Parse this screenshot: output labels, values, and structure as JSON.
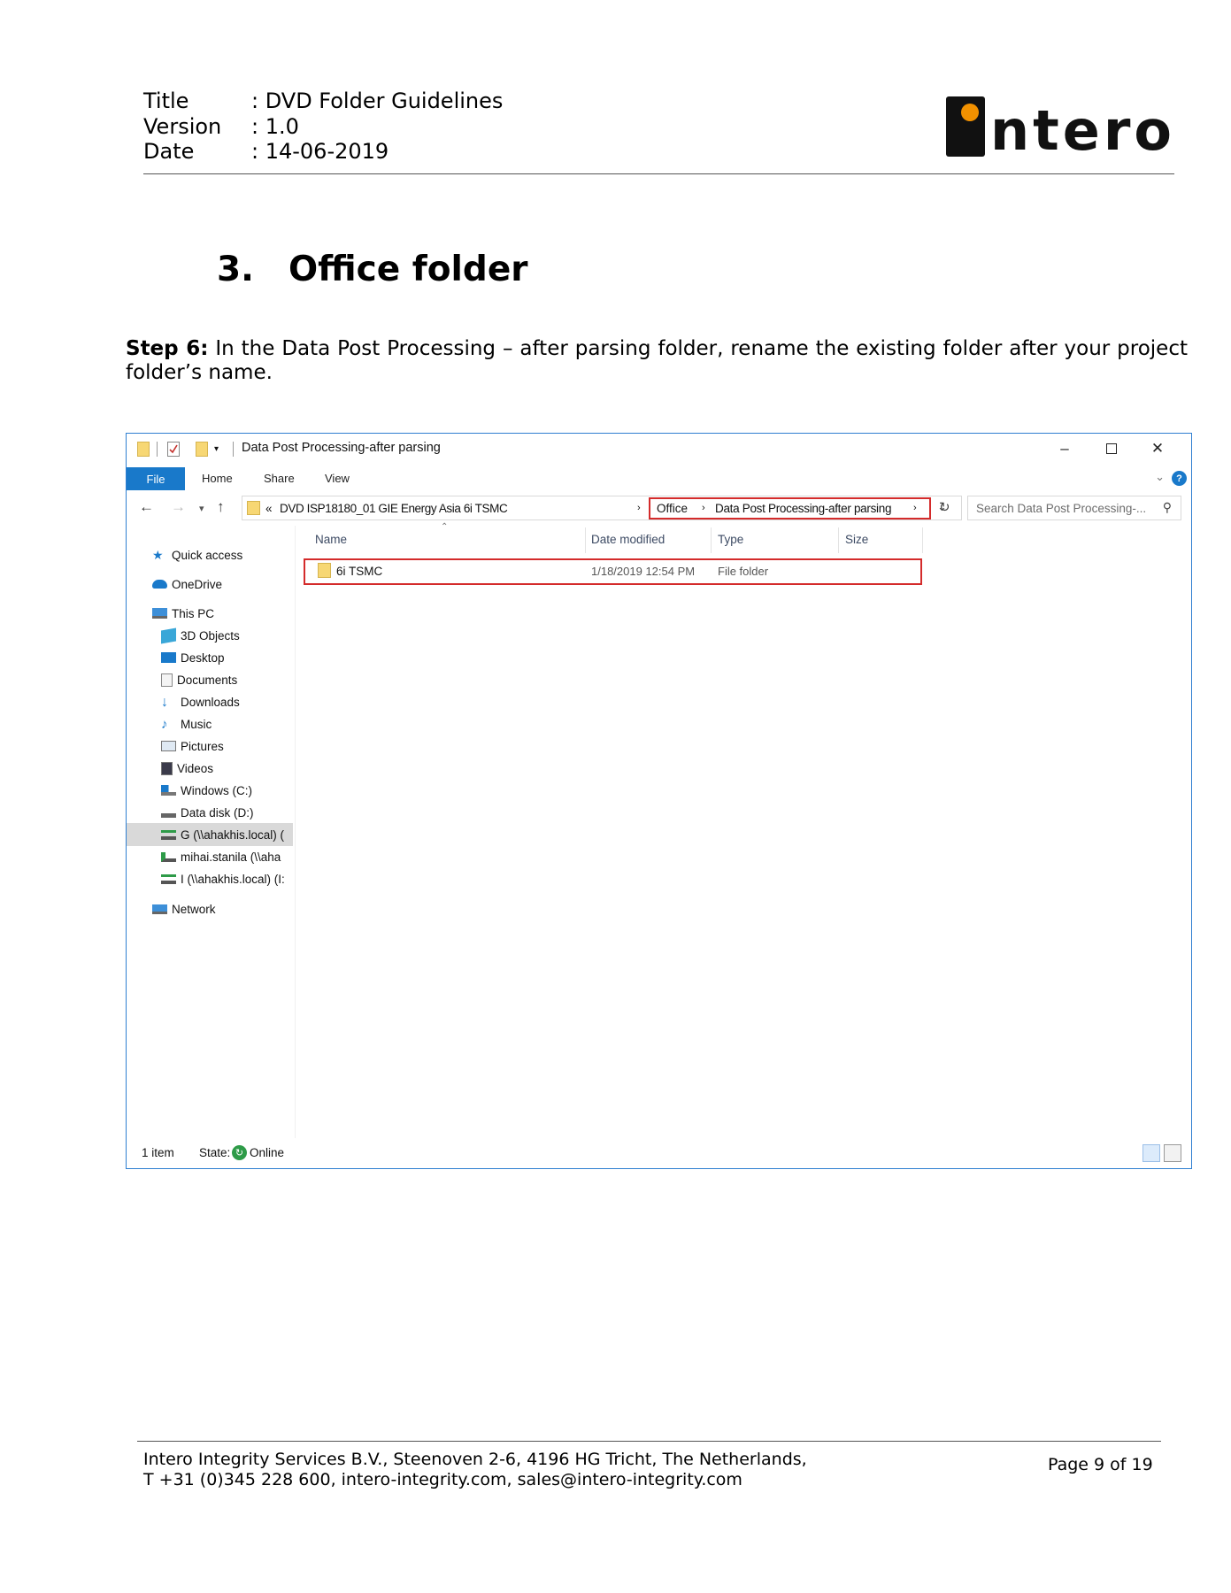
{
  "header": {
    "rows": [
      {
        "key": "Title",
        "value": ": DVD Folder Guidelines"
      },
      {
        "key": "Version",
        "value": ": 1.0"
      },
      {
        "key": "Date",
        "value": ": 14-06-2019"
      }
    ],
    "logo_text": "ntero"
  },
  "section": {
    "number": "3.",
    "title": "Office folder"
  },
  "step": {
    "label": "Step 6:",
    "text": " In the Data Post Processing – after parsing folder, rename the existing folder after your project folder’s name."
  },
  "explorer": {
    "window_title": "Data Post Processing-after parsing",
    "ribbon_tabs": [
      "File",
      "Home",
      "Share",
      "View"
    ],
    "help_label": "?",
    "breadcrumb": {
      "overflow": "«",
      "parent": "DVD ISP18180_01 GIE Energy Asia 6i TSMC",
      "office": "Office",
      "current": "Data Post Processing-after parsing"
    },
    "search_placeholder": "Search Data Post Processing-...",
    "sidebar": [
      {
        "label": "Quick access",
        "icon": "star-icon"
      },
      {
        "label": "OneDrive",
        "icon": "cloud-icon"
      },
      {
        "label": "This PC",
        "icon": "computer-icon"
      },
      {
        "label": "3D Objects",
        "icon": "cube-icon"
      },
      {
        "label": "Desktop",
        "icon": "desktop-icon"
      },
      {
        "label": "Documents",
        "icon": "documents-icon"
      },
      {
        "label": "Downloads",
        "icon": "download-arrow-icon"
      },
      {
        "label": "Music",
        "icon": "music-note-icon"
      },
      {
        "label": "Pictures",
        "icon": "pictures-icon"
      },
      {
        "label": "Videos",
        "icon": "videos-icon"
      },
      {
        "label": "Windows (C:)",
        "icon": "windows-drive-icon"
      },
      {
        "label": "Data disk (D:)",
        "icon": "drive-icon"
      },
      {
        "label": "G (\\\\ahakhis.local) (",
        "icon": "network-drive-icon"
      },
      {
        "label": "mihai.stanila (\\\\aha",
        "icon": "network-drive-online-icon"
      },
      {
        "label": "I (\\\\ahakhis.local) (I:",
        "icon": "network-drive-icon"
      },
      {
        "label": "Network",
        "icon": "network-icon"
      }
    ],
    "columns": [
      "Name",
      "Date modified",
      "Type",
      "Size"
    ],
    "rows": [
      {
        "name": "6i TSMC",
        "date": "1/18/2019 12:54 PM",
        "type": "File folder",
        "size": ""
      }
    ],
    "status": {
      "count": "1 item",
      "state_label": "State:",
      "state_value": "Online"
    }
  },
  "footer": {
    "line1": "Intero Integrity Services B.V., Steenoven 2-6, 4196 HG Tricht, The Netherlands,",
    "line2": "T +31 (0)345 228 600, intero-integrity.com, sales@intero-integrity.com",
    "page": "Page 9 of 19"
  },
  "colors": {
    "accent": "#1979ca",
    "highlight": "#d42b2b",
    "folder": "#f7d774"
  }
}
